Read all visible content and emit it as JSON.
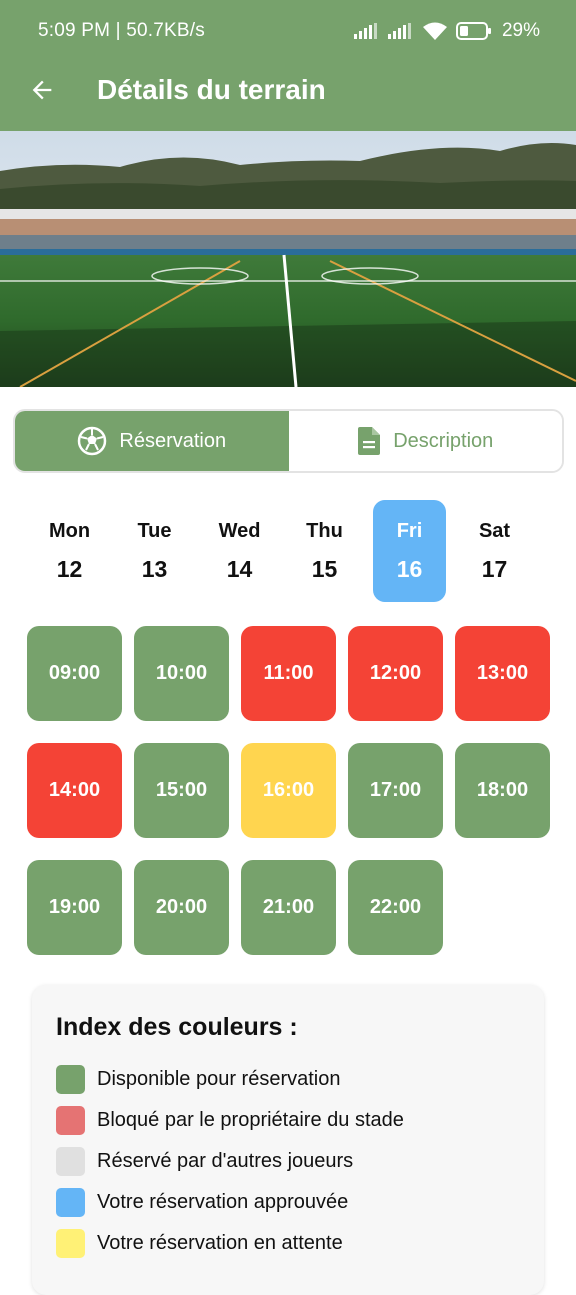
{
  "status_bar": {
    "time_speed": "5:09 PM | 50.7KB/s",
    "battery": "29%"
  },
  "appbar": {
    "title": "Détails du terrain",
    "back_icon": "arrow-left-icon"
  },
  "tabs": [
    {
      "label": "Réservation",
      "icon": "soccer-ball-icon",
      "active": true
    },
    {
      "label": "Description",
      "icon": "document-icon",
      "active": false
    }
  ],
  "days": [
    {
      "name": "Mon",
      "num": "12",
      "selected": false
    },
    {
      "name": "Tue",
      "num": "13",
      "selected": false
    },
    {
      "name": "Wed",
      "num": "14",
      "selected": false
    },
    {
      "name": "Thu",
      "num": "15",
      "selected": false
    },
    {
      "name": "Fri",
      "num": "16",
      "selected": true
    },
    {
      "name": "Sat",
      "num": "17",
      "selected": false
    }
  ],
  "slots": [
    {
      "time": "09:00",
      "status": "available"
    },
    {
      "time": "10:00",
      "status": "available"
    },
    {
      "time": "11:00",
      "status": "blocked"
    },
    {
      "time": "12:00",
      "status": "blocked"
    },
    {
      "time": "13:00",
      "status": "blocked"
    },
    {
      "time": "14:00",
      "status": "blocked"
    },
    {
      "time": "15:00",
      "status": "available"
    },
    {
      "time": "16:00",
      "status": "pending"
    },
    {
      "time": "17:00",
      "status": "available"
    },
    {
      "time": "18:00",
      "status": "available"
    },
    {
      "time": "19:00",
      "status": "available"
    },
    {
      "time": "20:00",
      "status": "available"
    },
    {
      "time": "21:00",
      "status": "available"
    },
    {
      "time": "22:00",
      "status": "available"
    }
  ],
  "slot_colors": {
    "available": "#77a26c",
    "blocked": "#f44336",
    "pending": "#ffd54f"
  },
  "legend": {
    "title": "Index des couleurs :",
    "items": [
      {
        "label": "Disponible pour réservation",
        "color": "#77a26c"
      },
      {
        "label": "Bloqué par le propriétaire du stade",
        "color": "#e57373"
      },
      {
        "label": "Réservé par d'autres joueurs",
        "color": "#e0e0e0"
      },
      {
        "label": "Votre réservation approuvée",
        "color": "#64b5f6"
      },
      {
        "label": "Votre réservation en attente",
        "color": "#fff176"
      }
    ]
  },
  "colors": {
    "primary": "#77a26c",
    "selected_day": "#64b5f6"
  }
}
